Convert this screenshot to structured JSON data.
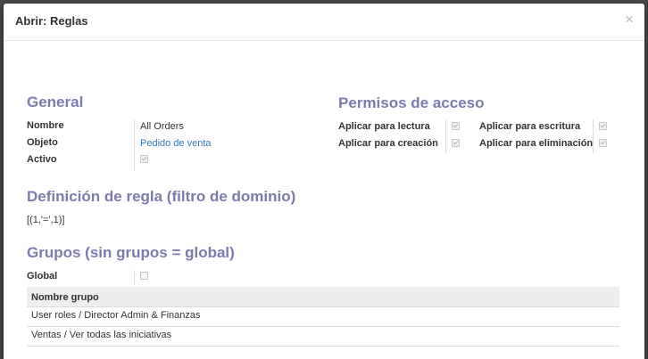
{
  "dialog": {
    "title": "Abrir: Reglas",
    "close_glyph": "×"
  },
  "general": {
    "title": "General",
    "name_label": "Nombre",
    "name_value": "All Orders",
    "object_label": "Objeto",
    "object_value": "Pedido de venta",
    "active_label": "Activo",
    "active_checked": true
  },
  "permissions": {
    "title": "Permisos de acceso",
    "read_label": "Aplicar para lectura",
    "read_checked": true,
    "write_label": "Aplicar para escritura",
    "write_checked": true,
    "create_label": "Aplicar para creación",
    "create_checked": true,
    "delete_label": "Aplicar para eliminación",
    "delete_checked": true
  },
  "rule": {
    "title": "Definición de regla (filtro de dominio)",
    "domain": "[(1,'=',1)]"
  },
  "groups": {
    "title": "Grupos (sin grupos = global)",
    "global_label": "Global",
    "global_checked": false,
    "column_header": "Nombre grupo",
    "rows": [
      "User roles / Director Admin & Finanzas",
      "Ventas / Ver todas las iniciativas"
    ]
  }
}
